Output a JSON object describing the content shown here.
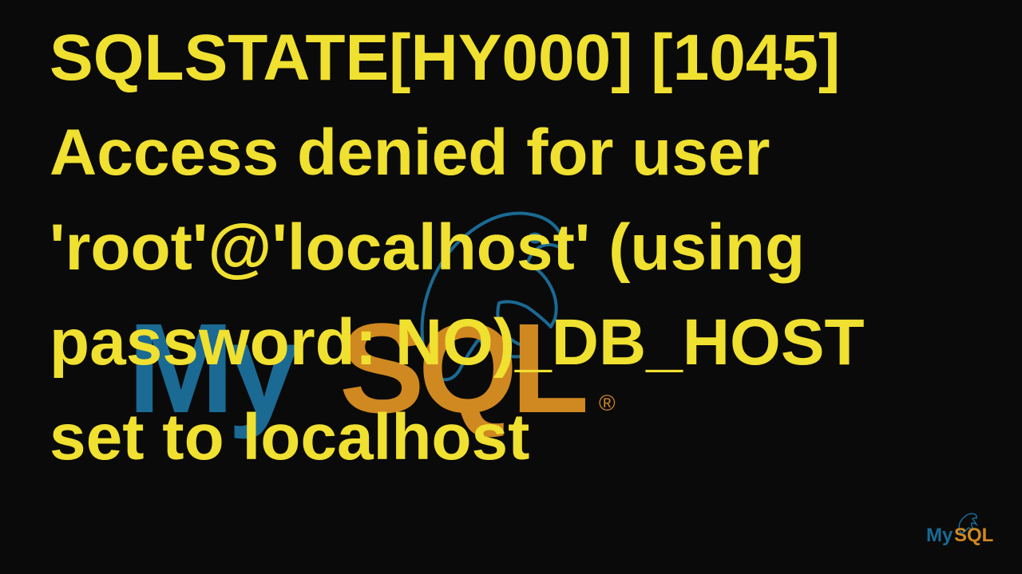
{
  "error": {
    "message": "SQLSTATE[HY000] [1045] Access denied for user 'root'@'localhost' (using password: NO)_DB_HOST set to localhost"
  },
  "logo": {
    "my": "My",
    "sql": "SQL",
    "registered": "®"
  },
  "small_logo": {
    "my": "My",
    "sql": "SQL"
  }
}
